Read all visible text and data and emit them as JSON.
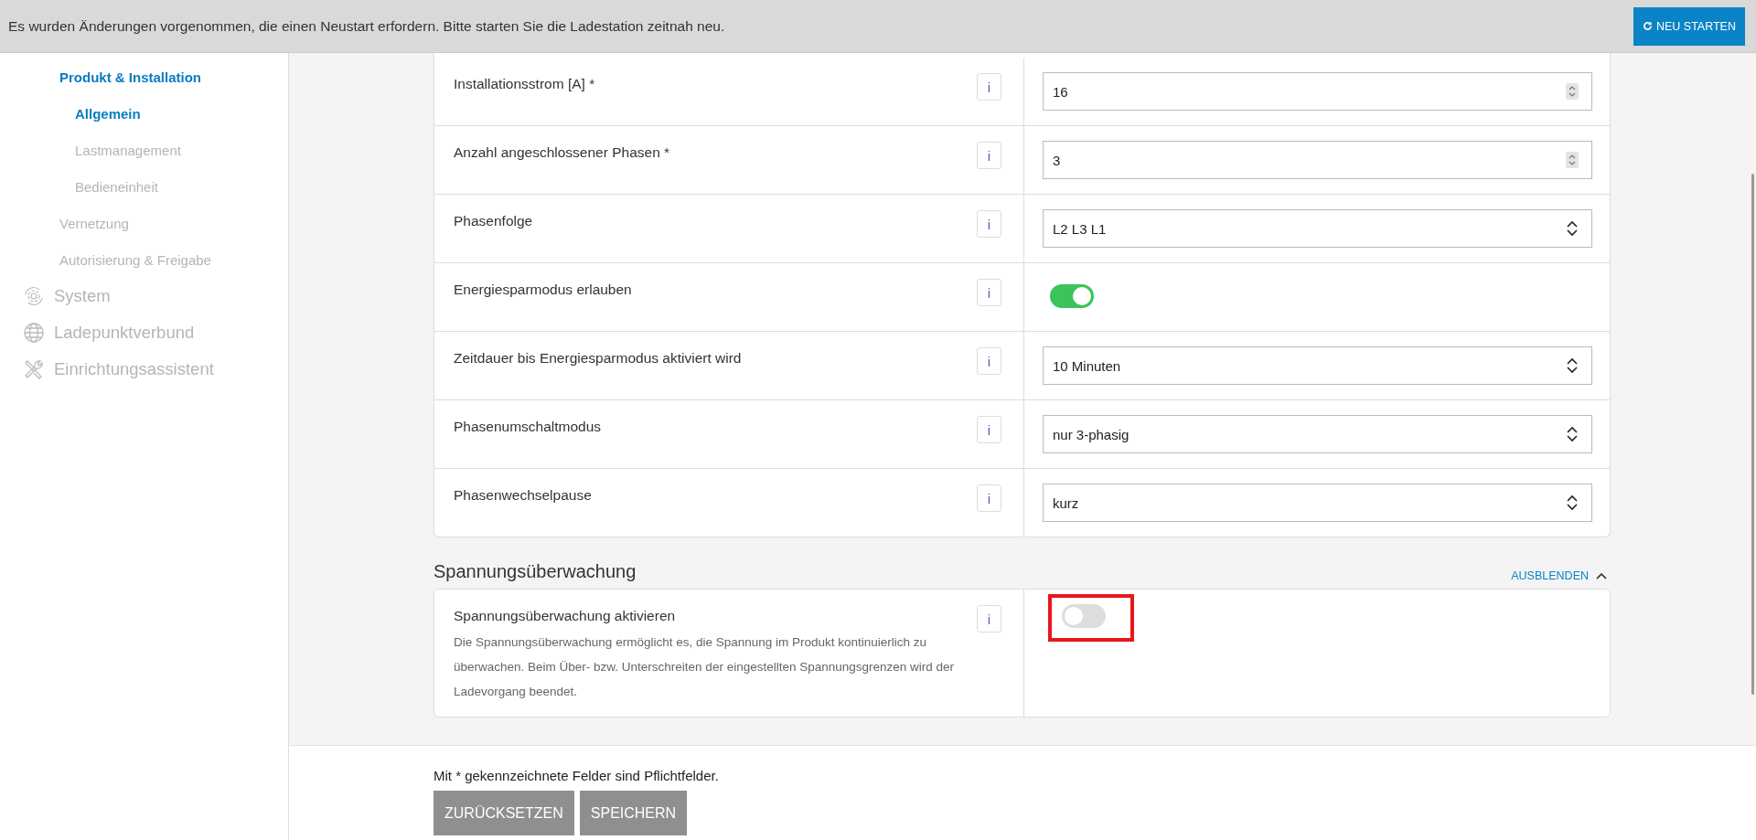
{
  "banner": {
    "message": "Es wurden Änderungen vorgenommen, die einen Neustart erfordern. Bitte starten Sie die Ladestation zeitnah neu.",
    "button": "NEU STARTEN"
  },
  "sidebar": {
    "items": [
      {
        "label": "Produkt & Installation",
        "selected": true,
        "children": [
          {
            "label": "Allgemein",
            "selected": true
          },
          {
            "label": "Lastmanagement",
            "selected": false
          },
          {
            "label": "Bedieneinheit",
            "selected": false
          }
        ]
      },
      {
        "label": "Vernetzung",
        "selected": false
      },
      {
        "label": "Autorisierung & Freigabe",
        "selected": false
      },
      {
        "label": "System",
        "kind": "gear",
        "selected": false
      },
      {
        "label": "Ladepunktverbund",
        "kind": "globe",
        "selected": false
      },
      {
        "label": "Einrichtungsassistent",
        "kind": "tools",
        "selected": false
      }
    ]
  },
  "settings": {
    "rows": [
      {
        "label": "Installationsstrom [A] *",
        "info": "i",
        "kind": "number",
        "value": "16"
      },
      {
        "label": "Anzahl angeschlossener Phasen *",
        "info": "i",
        "kind": "number",
        "value": "3"
      },
      {
        "label": "Phasenfolge",
        "info": "i",
        "kind": "select",
        "value": "L2 L3 L1"
      },
      {
        "label": "Energiesparmodus erlauben",
        "info": "i",
        "kind": "toggle",
        "on": true
      },
      {
        "label": "Zeitdauer bis Energiesparmodus aktiviert wird",
        "info": "i",
        "kind": "select",
        "value": "10 Minuten"
      },
      {
        "label": "Phasenumschaltmodus",
        "info": "i",
        "kind": "select",
        "value": "nur 3-phasig"
      },
      {
        "label": "Phasenwechselpause",
        "info": "i",
        "kind": "select",
        "value": "kurz"
      }
    ]
  },
  "voltage_section": {
    "title": "Spannungsüberwachung",
    "collapse": "AUSBLENDEN",
    "expanded": true,
    "rows": [
      {
        "label": "Spannungsüberwachung aktivieren",
        "info": "i",
        "description": "Die Spannungsüberwachung ermöglicht es, die Spannung im Produkt kontinuierlich zu überwachen. Beim Über- bzw. Unterschreiten der eingestellten Spannungsgrenzen wird der Ladevorgang beendet.",
        "kind": "toggle",
        "on": false,
        "highlighted": true
      }
    ]
  },
  "footer": {
    "note": "Mit * gekennzeichnete Felder sind Pflichtfelder.",
    "buttons": [
      {
        "label": "ZURÜCKSETZEN",
        "disabled": true
      },
      {
        "label": "SPEICHERN",
        "disabled": true
      }
    ]
  }
}
